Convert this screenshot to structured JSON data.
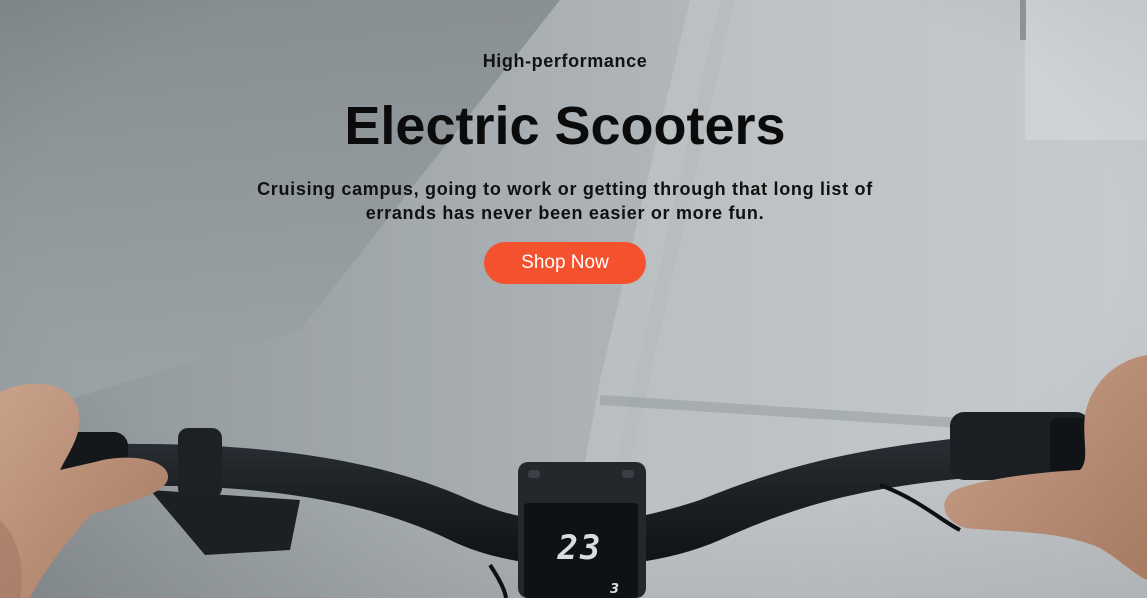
{
  "hero": {
    "eyebrow": "High-performance",
    "title": "Electric Scooters",
    "subtitle": "Cruising campus, going to work or getting through that long list of errands has never been easier or more fun.",
    "cta_label": "Shop Now",
    "display_speed": "23",
    "display_gear": "3"
  },
  "colors": {
    "cta_background": "#f4512e",
    "cta_text": "#ffffff",
    "heading_text": "#0b0b0b"
  }
}
